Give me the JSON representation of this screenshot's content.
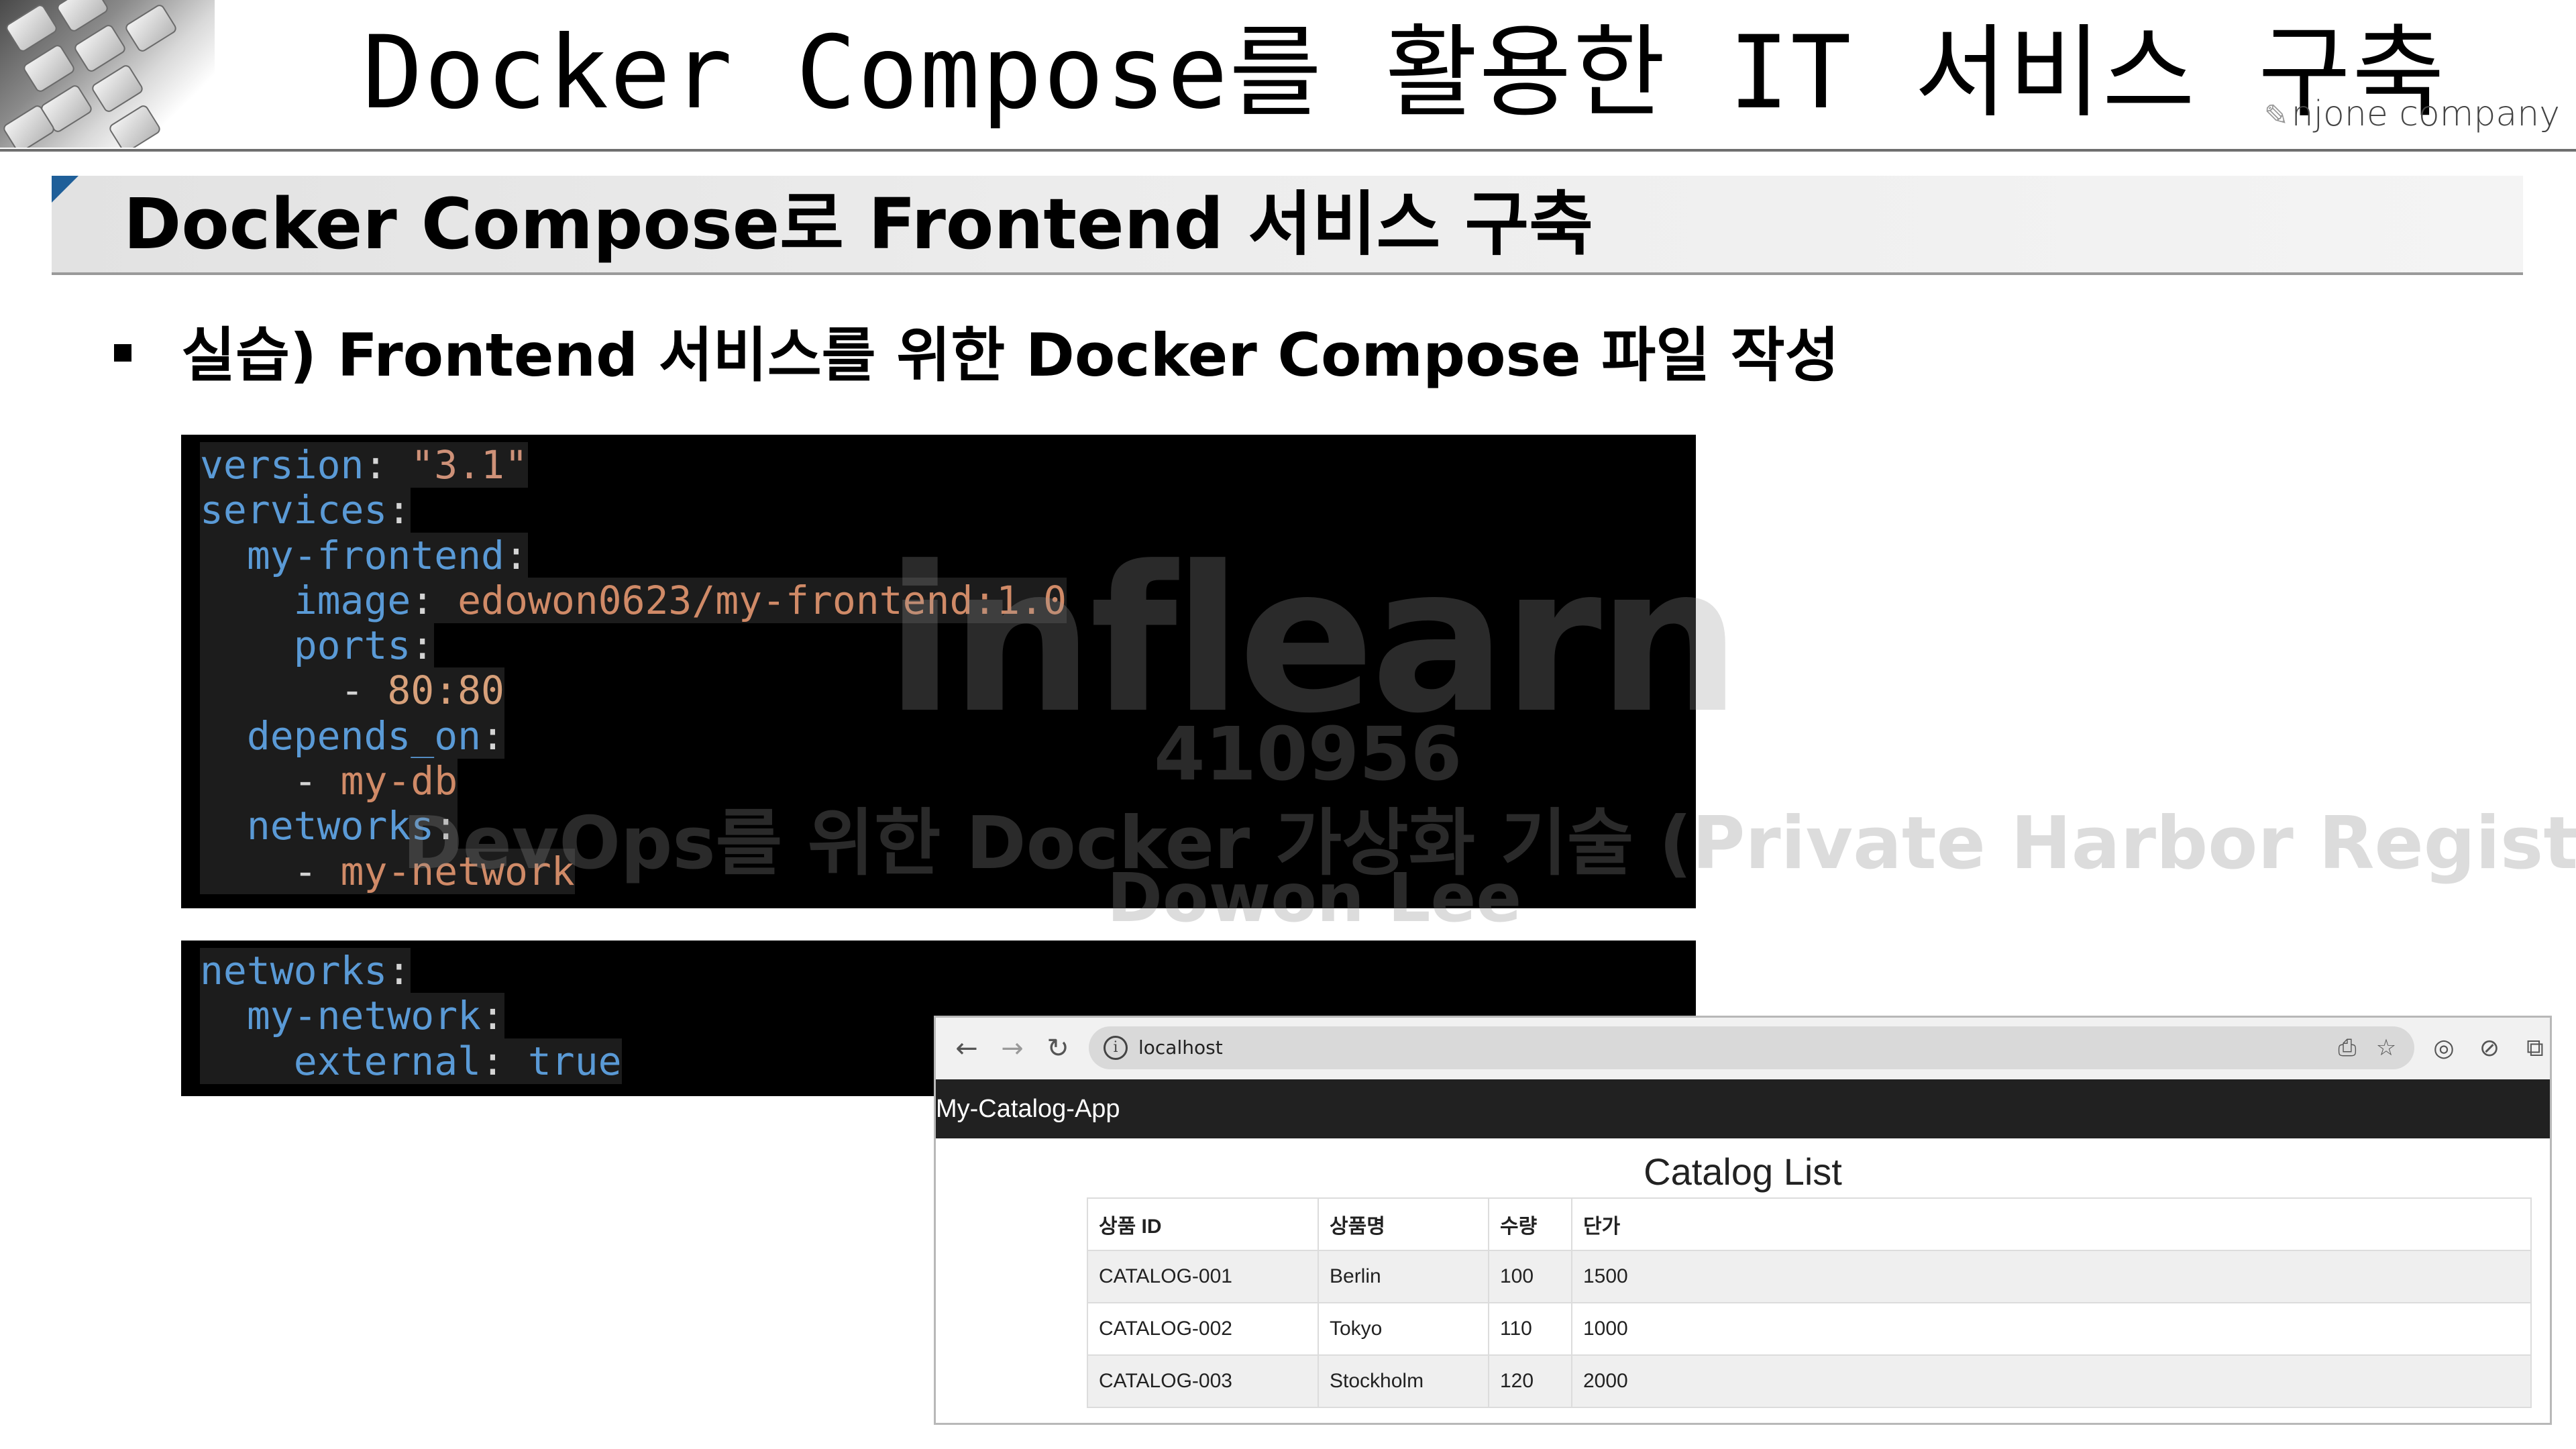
{
  "slide": {
    "title": "Docker Compose를 활용한 IT 서비스 구축",
    "company": "njone company",
    "section_title": "Docker Compose로 Frontend 서비스 구축",
    "bullet": "실습) Frontend 서비스를 위한 Docker Compose 파일 작성"
  },
  "code": {
    "block1": {
      "version_key": "version",
      "version_value": "\"3.1\"",
      "services_key": "services",
      "service_name": "my-frontend",
      "image_key": "image",
      "image_value": "edowon0623/my-frontend:1.0",
      "ports_key": "ports",
      "port_value": "80:80",
      "depends_key": "depends_on",
      "depends_value": "my-db",
      "networks_key": "networks",
      "network_value": "my-network"
    },
    "block2": {
      "networks_key": "networks",
      "network_name": "my-network",
      "external_key": "external",
      "external_value": "true"
    }
  },
  "watermark": {
    "logo": "inflearn",
    "id": "410956",
    "course": "DevOps를 위한 Docker 가상화 기술 (Private Harbor Registry)",
    "author": "Dowon Lee"
  },
  "browser": {
    "url": "localhost",
    "app_brand": "My-Catalog-App",
    "page_heading": "Catalog List",
    "table": {
      "headers": [
        "상품 ID",
        "상품명",
        "수량",
        "단가"
      ],
      "rows": [
        [
          "CATALOG-001",
          "Berlin",
          "100",
          "1500"
        ],
        [
          "CATALOG-002",
          "Tokyo",
          "110",
          "1000"
        ],
        [
          "CATALOG-003",
          "Stockholm",
          "120",
          "2000"
        ]
      ]
    }
  },
  "colors": {
    "code_key": "#5a9ad6",
    "code_string": "#ce9178",
    "navbar": "#212121",
    "section_corner": "#1f5f99"
  }
}
